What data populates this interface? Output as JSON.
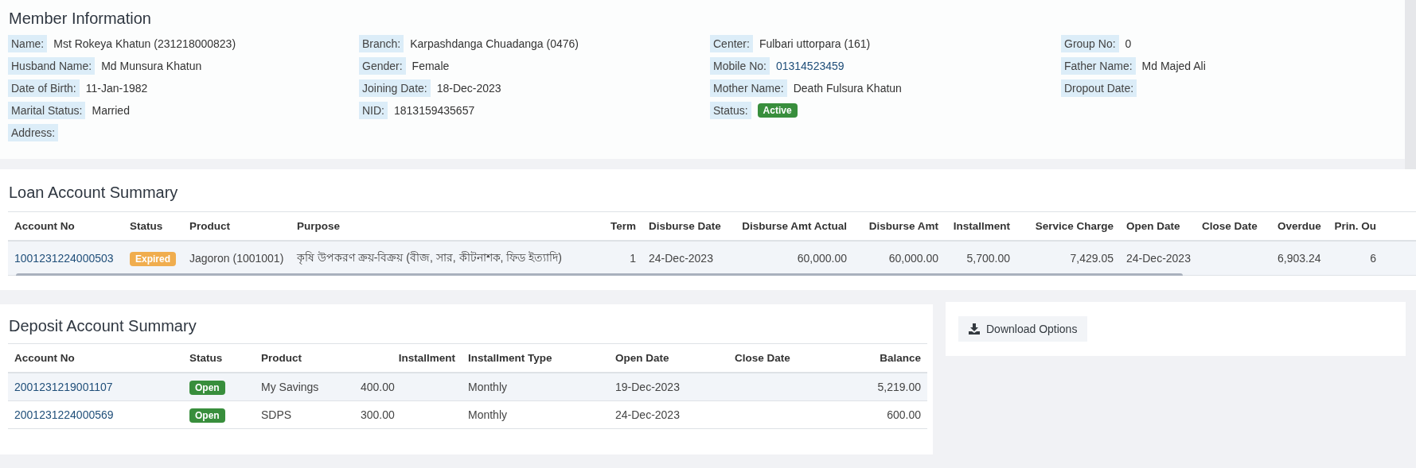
{
  "member": {
    "title": "Member Information",
    "rows": [
      [
        {
          "label": "Name:",
          "value": "Mst Rokeya Khatun (231218000823)"
        },
        {
          "label": "Branch:",
          "value": "Karpashdanga Chuadanga (0476)"
        },
        {
          "label": "Center:",
          "value": "Fulbari uttorpara (161)"
        },
        {
          "label": "Group No:",
          "value": "0"
        }
      ],
      [
        {
          "label": "Husband Name:",
          "value": "Md Munsura Khatun"
        },
        {
          "label": "Gender:",
          "value": "Female"
        },
        {
          "label": "Mobile No:",
          "value": "01314523459",
          "kind": "link"
        },
        {
          "label": "Father Name:",
          "value": "Md Majed Ali"
        }
      ],
      [
        {
          "label": "Date of Birth:",
          "value": "11-Jan-1982"
        },
        {
          "label": "Joining Date:",
          "value": "18-Dec-2023"
        },
        {
          "label": "Mother Name:",
          "value": "Death Fulsura Khatun"
        },
        {
          "label": "Dropout Date:"
        }
      ],
      [
        {
          "label": "Marital Status:",
          "value": "Married"
        },
        {
          "label": "NID:",
          "value": "1813159435657"
        },
        {
          "label": "Status:",
          "badge": {
            "text": "Active",
            "color": "#388e3c"
          }
        }
      ],
      [
        {
          "label": "Address:"
        }
      ]
    ]
  },
  "loan": {
    "title": "Loan Account Summary",
    "columns": [
      "Account No",
      "Status",
      "Product",
      "Purpose",
      "Term",
      "Disburse Date",
      "Disburse Amt Actual",
      "Disburse Amt",
      "Installment",
      "Service Charge",
      "Open Date",
      "Close Date",
      "Overdue",
      "Prin. Ou"
    ],
    "rows": [
      {
        "cells": [
          {
            "kind": "link",
            "text": "1001231224000503"
          },
          {
            "kind": "badge",
            "text": "Expired",
            "color": "#f0ad4e"
          },
          {
            "text": "Jagoron (1001001)"
          },
          {
            "text": "কৃষি উপকরণ ক্রয়-বিক্রয় (বীজ, সার, কীটনাশক, ফিড ইত্যাদি)"
          },
          {
            "text": "1"
          },
          {
            "text": "24-Dec-2023"
          },
          {
            "text": "60,000.00"
          },
          {
            "text": "60,000.00"
          },
          {
            "text": "5,700.00"
          },
          {
            "text": "7,429.05"
          },
          {
            "text": "24-Dec-2023"
          },
          {
            "text": ""
          },
          {
            "text": "6,903.24"
          },
          {
            "text": "6"
          }
        ]
      }
    ]
  },
  "deposit": {
    "title": "Deposit Account Summary",
    "columns": [
      "Account No",
      "Status",
      "Product",
      "Installment",
      "Installment Type",
      "Open Date",
      "Close Date",
      "Balance"
    ],
    "rows": [
      {
        "cells": [
          {
            "kind": "link",
            "text": "2001231219001107"
          },
          {
            "kind": "badge",
            "text": "Open",
            "color": "#388e3c"
          },
          {
            "text": "My Savings"
          },
          {
            "text": "400.00"
          },
          {
            "text": "Monthly"
          },
          {
            "text": "19-Dec-2023"
          },
          {
            "text": ""
          },
          {
            "text": "5,219.00"
          }
        ]
      },
      {
        "cells": [
          {
            "kind": "link",
            "text": "2001231224000569"
          },
          {
            "kind": "badge",
            "text": "Open",
            "color": "#388e3c"
          },
          {
            "text": "SDPS"
          },
          {
            "text": "300.00"
          },
          {
            "text": "Monthly"
          },
          {
            "text": "24-Dec-2023"
          },
          {
            "text": ""
          },
          {
            "text": "600.00"
          }
        ]
      }
    ]
  },
  "download_button": "Download Options"
}
